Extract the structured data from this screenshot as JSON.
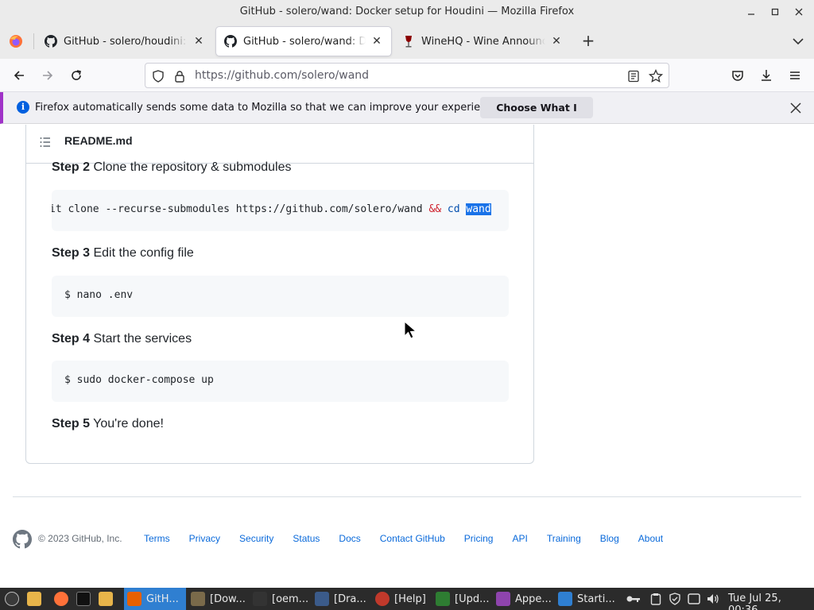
{
  "window": {
    "title": "GitHub - solero/wand: Docker setup for Houdini — Mozilla Firefox"
  },
  "tabs": [
    {
      "label": "GitHub - solero/houdini: A C",
      "icon": "github-icon",
      "active": false
    },
    {
      "label": "GitHub - solero/wand: Dock",
      "icon": "github-icon",
      "active": true
    },
    {
      "label": "WineHQ - Wine Announcem",
      "icon": "winehq-icon",
      "active": false
    }
  ],
  "navbar": {
    "url": "https://github.com/solero/wand"
  },
  "notification": {
    "message": "Firefox automatically sends some data to Mozilla so that we can improve your experience.",
    "button_label": "Choose What I Share"
  },
  "readme": {
    "filename": "README.md",
    "steps": [
      {
        "num": "Step 2",
        "text": "Clone the repository & submodules"
      },
      {
        "num": "Step 3",
        "text": "Edit the config file"
      },
      {
        "num": "Step 4",
        "text": "Start the services"
      },
      {
        "num": "Step 5",
        "text": "You're done!"
      }
    ],
    "code": {
      "clone_prefix": "it clone --recurse-submodules https://github.com/solero/wand ",
      "clone_op": "&&",
      "clone_cd": "cd",
      "clone_sel": "wand",
      "nano": "$ nano .env",
      "compose": "$ sudo docker-compose up"
    }
  },
  "footer": {
    "copyright": "© 2023 GitHub, Inc.",
    "links": [
      "Terms",
      "Privacy",
      "Security",
      "Status",
      "Docs",
      "Contact GitHub",
      "Pricing",
      "API",
      "Training",
      "Blog",
      "About"
    ]
  },
  "taskbar": {
    "items": [
      {
        "label": "GitH...",
        "active": true,
        "color": "#e66000"
      },
      {
        "label": "[Dow...",
        "active": false,
        "color": "#7a6a4a"
      },
      {
        "label": "[oem...",
        "active": false,
        "color": "#333333"
      },
      {
        "label": "[Dra...",
        "active": false,
        "color": "#3b5b8a"
      },
      {
        "label": "[Help]",
        "active": false,
        "color": "#c0392b"
      },
      {
        "label": "[Upd...",
        "active": false,
        "color": "#2e7d32"
      },
      {
        "label": "Appe...",
        "active": false,
        "color": "#8e44ad"
      },
      {
        "label": "Starti...",
        "active": false,
        "color": "#2f7fd1"
      }
    ],
    "clock": "Tue Jul 25, 00:36"
  },
  "colors": {
    "accent": "#0060df",
    "notification_stripe": "#a033c8",
    "link": "#0969da",
    "taskbar_active": "#2f7fd1"
  }
}
